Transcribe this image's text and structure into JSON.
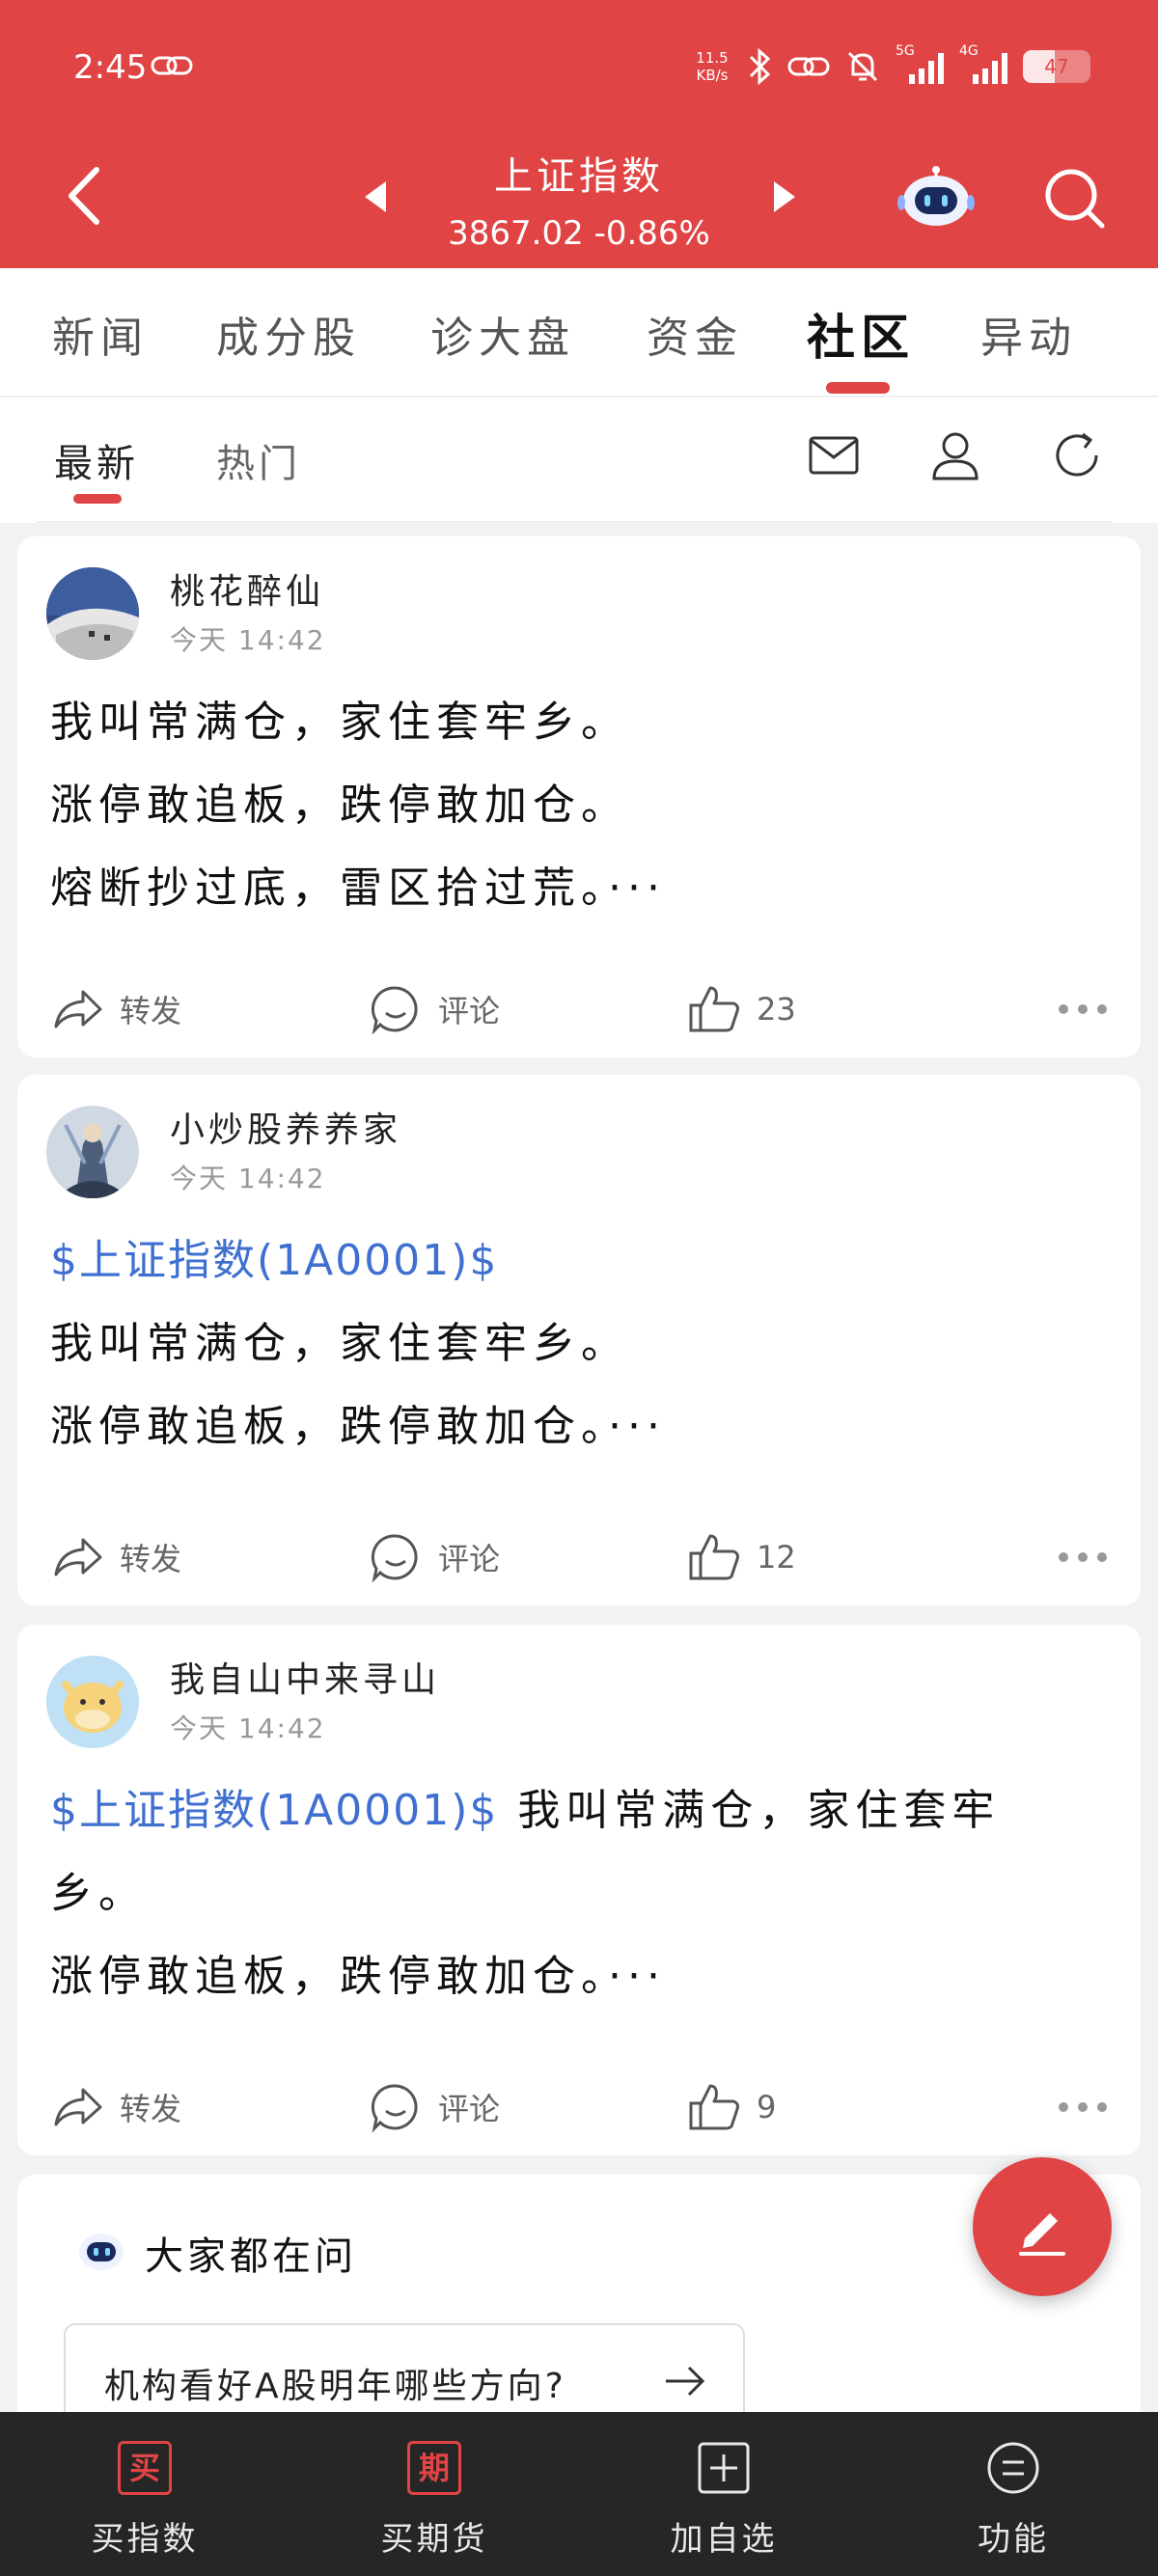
{
  "status_bar": {
    "time": "2:45",
    "net_speed_value": "11.5",
    "net_speed_unit": "KB/s",
    "signal_1_label": "5G",
    "signal_2_label": "4G",
    "battery_text": "47",
    "battery_level": 0.47
  },
  "header": {
    "title": "上证指数",
    "quote": "3867.02 -0.86%"
  },
  "tabs": [
    {
      "label": "新闻"
    },
    {
      "label": "成分股"
    },
    {
      "label": "诊大盘"
    },
    {
      "label": "资金"
    },
    {
      "label": "社区"
    },
    {
      "label": "异动"
    }
  ],
  "active_tab": "社区",
  "subtabs": [
    {
      "label": "最新"
    },
    {
      "label": "热门"
    }
  ],
  "posts": [
    {
      "author": "桃花醉仙",
      "time": "今天 14:42",
      "stock_tag": "",
      "lines": [
        "我叫常满仓，家住套牢乡。",
        "涨停敢追板，跌停敢加仓。",
        "熔断抄过底，雷区拾过荒。···"
      ],
      "forward_label": "转发",
      "comment_label": "评论",
      "likes": "23"
    },
    {
      "author": "小炒股养养家",
      "time": "今天 14:42",
      "stock_tag": "$上证指数(1A0001)$",
      "lines": [
        "我叫常满仓，家住套牢乡。",
        "涨停敢追板，跌停敢加仓。···"
      ],
      "forward_label": "转发",
      "comment_label": "评论",
      "likes": "12"
    },
    {
      "author": "我自山中来寻山",
      "time": "今天 14:42",
      "stock_tag": "$上证指数(1A0001)$",
      "inline_text": " 我叫常满仓，家住套牢乡。",
      "lines": [
        "涨停敢追板，跌停敢加仓。···"
      ],
      "forward_label": "转发",
      "comment_label": "评论",
      "likes": "9"
    }
  ],
  "ask_section": {
    "title": "大家都在问",
    "question": "机构看好A股明年哪些方向?"
  },
  "bottom_nav": [
    {
      "label": "买指数",
      "icon_char": "买",
      "icon": "buy-box-icon"
    },
    {
      "label": "买期货",
      "icon_char": "期",
      "icon": "futures-box-icon"
    },
    {
      "label": "加自选",
      "icon": "plus-box-icon"
    },
    {
      "label": "功能",
      "icon": "menu-circle-icon"
    }
  ],
  "colors": {
    "brand_red": "#e04444",
    "stock_link_blue": "#3f6fd0",
    "bottom_nav_bg": "#262626"
  }
}
